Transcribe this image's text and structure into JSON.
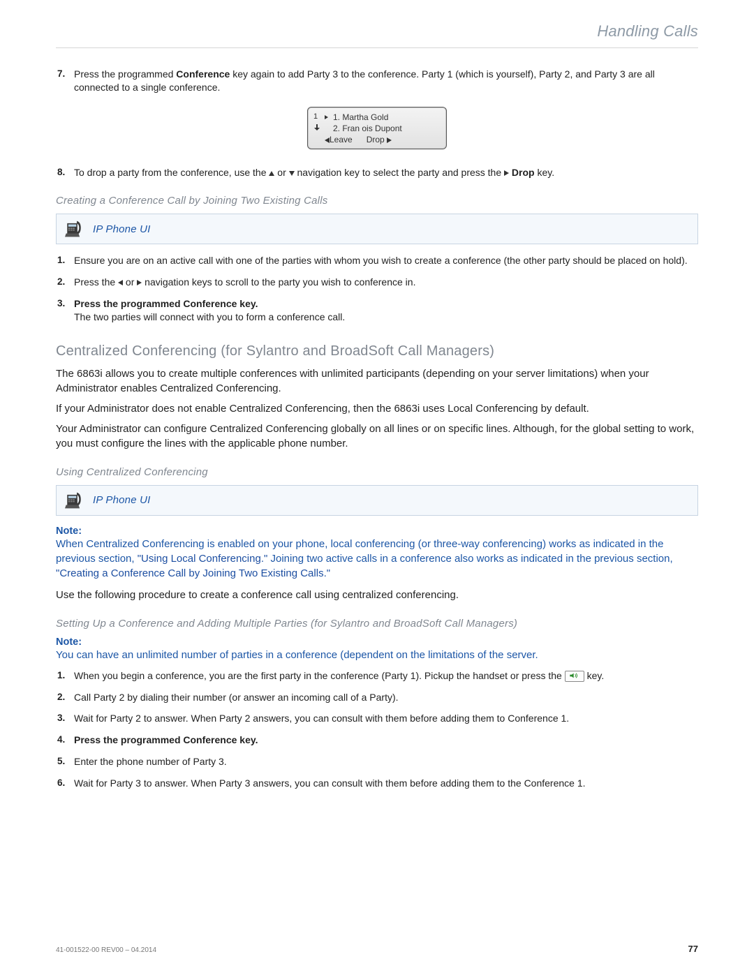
{
  "header": {
    "title": "Handling Calls"
  },
  "top_steps": {
    "s7_num": "7.",
    "s7_a": "Press the programmed ",
    "s7_b": "Conference",
    "s7_c": " key again to add Party 3 to the conference. Party 1 (which is yourself), Party 2, and Party 3 are all connected to a single conference.",
    "s8_num": "8.",
    "s8_a": "To drop a party from the conference, use the ",
    "s8_b": " or ",
    "s8_c": " navigation key to select the party and press the ",
    "s8_d": " Drop",
    "s8_e": " key."
  },
  "screen": {
    "col_left_top": "1",
    "line1": "1. Martha Gold",
    "line2": "2. Fran ois Dupont",
    "leave": "Leave",
    "drop": "Drop"
  },
  "sec_join": {
    "h": "Creating a Conference Call by Joining Two Existing Calls",
    "ipbox": "IP Phone UI",
    "s1_num": "1.",
    "s1": "Ensure you are on an active call with one of the parties with whom you wish to create a conference (the other party should be placed on hold).",
    "s2_num": "2.",
    "s2_a": "Press the ",
    "s2_b": " or ",
    "s2_c": " navigation keys to scroll to the party you wish to conference in.",
    "s3_num": "3.",
    "s3_a": "Press the programmed ",
    "s3_b": "Conference",
    "s3_c": " key.",
    "s3_sub": "The two parties will connect with you to form a conference call."
  },
  "sec_central": {
    "h": "Centralized Conferencing (for Sylantro and BroadSoft Call Managers)",
    "p1": "The 6863i allows you to create multiple conferences with unlimited participants (depending on your server limitations) when your Administrator enables Centralized Conferencing.",
    "p2": "If your Administrator does not enable Centralized Conferencing, then the 6863i uses Local Conferencing by default.",
    "p3": "Your Administrator can configure Centralized Conferencing globally on all lines or on specific lines. Although, for the global setting to work, you must configure the lines with the applicable phone number."
  },
  "sec_use": {
    "h": "Using Centralized Conferencing",
    "ipbox": "IP Phone UI",
    "note_label": "Note:",
    "note_a": "When Centralized Conferencing is enabled on your phone, local conferencing (or three-way conferencing) works as indicated in the previous section, ",
    "note_link1": "\"Using Local Conferencing.\"",
    "note_b": " Joining two active calls in a conference also works as indicated in the previous section, ",
    "note_link2": "\"Creating a Conference Call by Joining Two Existing Calls.\"",
    "p": "Use the following procedure to create a conference call using centralized conferencing."
  },
  "sec_setup": {
    "h": "Setting Up a Conference and Adding Multiple Parties (for Sylantro and BroadSoft Call Managers)",
    "note_label": "Note:",
    "note": "You can have an unlimited number of parties in a conference (dependent on the limitations of the server.",
    "s1_num": "1.",
    "s1_a": "When you begin a conference, you are the first party in the conference (Party 1). Pickup the handset or press the ",
    "s1_b": " key.",
    "s2_num": "2.",
    "s2": "Call Party 2 by dialing their number (or answer an incoming call of a Party).",
    "s3_num": "3.",
    "s3": "Wait for Party 2 to answer. When Party 2 answers, you can consult with them before adding them to Conference 1.",
    "s4_num": "4.",
    "s4_a": "Press the programmed ",
    "s4_b": "Conference",
    "s4_c": " key.",
    "s5_num": "5.",
    "s5": "Enter the phone number of Party 3.",
    "s6_num": "6.",
    "s6": "Wait for Party 3 to answer. When Party 3 answers, you can consult with them before adding them to the Conference 1."
  },
  "footer": {
    "doc": "41-001522-00 REV00 – 04.2014",
    "page": "77"
  }
}
